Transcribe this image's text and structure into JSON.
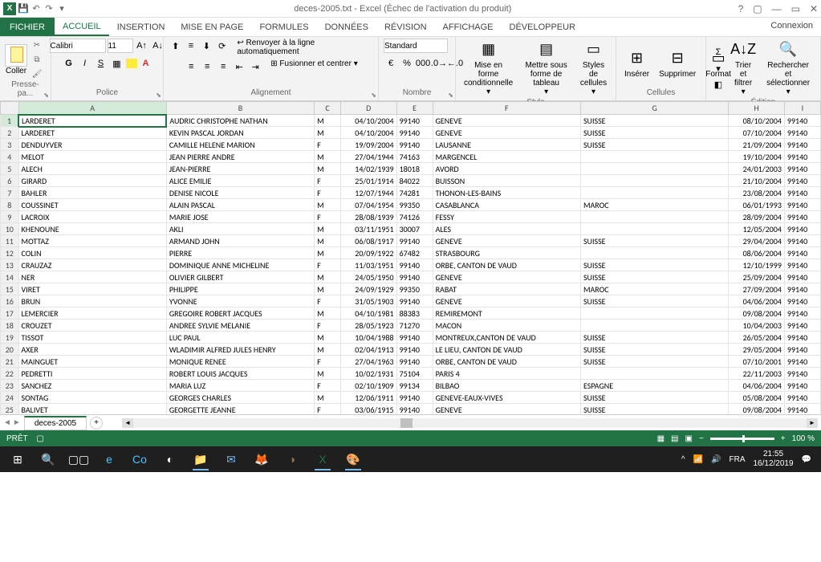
{
  "title": "deces-2005.txt - Excel (Échec de l'activation du produit)",
  "win_controls": {
    "help": "?",
    "ribbon_opts": "▢",
    "min": "—",
    "restore": "▭",
    "close": "✕"
  },
  "connexion": "Connexion",
  "tabs": {
    "fichier": "FICHIER",
    "accueil": "ACCUEIL",
    "insertion": "INSERTION",
    "mise_en_page": "MISE EN PAGE",
    "formules": "FORMULES",
    "donnees": "DONNÉES",
    "revision": "RÉVISION",
    "affichage": "AFFICHAGE",
    "developpeur": "DÉVELOPPEUR"
  },
  "ribbon": {
    "presse": {
      "label": "Presse-pa...",
      "coller": "Coller"
    },
    "police": {
      "label": "Police",
      "font": "Calibri",
      "size": "11"
    },
    "alignement": {
      "label": "Alignement",
      "wrap": "Renvoyer à la ligne automatiquement",
      "merge": "Fusionner et centrer"
    },
    "nombre": {
      "label": "Nombre",
      "format": "Standard"
    },
    "style": {
      "label": "Style",
      "conditional": "Mise en forme conditionnelle",
      "table": "Mettre sous forme de tableau",
      "cell": "Styles de cellules"
    },
    "cellules": {
      "label": "Cellules",
      "insert": "Insérer",
      "delete": "Supprimer",
      "format": "Format"
    },
    "edition": {
      "label": "Édition",
      "sort": "Trier et filtrer",
      "find": "Rechercher et sélectionner"
    }
  },
  "columns": [
    "A",
    "B",
    "C",
    "D",
    "E",
    "F",
    "G",
    "H",
    "I"
  ],
  "rows": [
    {
      "n": 1,
      "A": "LARDERET",
      "B": "AUDRIC CHRISTOPHE NATHAN",
      "C": "M",
      "D": "04/10/2004",
      "E": "99140",
      "F": "GENEVE",
      "G": "SUISSE",
      "H": "08/10/2004",
      "I": "99140"
    },
    {
      "n": 2,
      "A": "LARDERET",
      "B": "KEVIN PASCAL JORDAN",
      "C": "M",
      "D": "04/10/2004",
      "E": "99140",
      "F": "GENEVE",
      "G": "SUISSE",
      "H": "07/10/2004",
      "I": "99140"
    },
    {
      "n": 3,
      "A": "DENDUYVER",
      "B": "CAMILLE HELENE MARION",
      "C": "F",
      "D": "19/09/2004",
      "E": "99140",
      "F": "LAUSANNE",
      "G": "SUISSE",
      "H": "21/09/2004",
      "I": "99140"
    },
    {
      "n": 4,
      "A": "MELOT",
      "B": "JEAN PIERRE ANDRE",
      "C": "M",
      "D": "27/04/1944",
      "E": "74163",
      "F": "MARGENCEL",
      "G": "",
      "H": "19/10/2004",
      "I": "99140"
    },
    {
      "n": 5,
      "A": "ALECH",
      "B": "JEAN-PIERRE",
      "C": "M",
      "D": "14/02/1939",
      "E": "18018",
      "F": "AVORD",
      "G": "",
      "H": "24/01/2003",
      "I": "99140"
    },
    {
      "n": 6,
      "A": "GIRARD",
      "B": "ALICE EMILIE",
      "C": "F",
      "D": "25/01/1914",
      "E": "84022",
      "F": "BUISSON",
      "G": "",
      "H": "21/10/2004",
      "I": "99140"
    },
    {
      "n": 7,
      "A": "BAHLER",
      "B": "DENISE NICOLE",
      "C": "F",
      "D": "12/07/1944",
      "E": "74281",
      "F": "THONON-LES-BAINS",
      "G": "",
      "H": "23/08/2004",
      "I": "99140"
    },
    {
      "n": 8,
      "A": "COUSSINET",
      "B": "ALAIN PASCAL",
      "C": "M",
      "D": "07/04/1954",
      "E": "99350",
      "F": "CASABLANCA",
      "G": "MAROC",
      "H": "06/01/1993",
      "I": "99140"
    },
    {
      "n": 9,
      "A": "LACROIX",
      "B": "MARIE JOSE",
      "C": "F",
      "D": "28/08/1939",
      "E": "74126",
      "F": "FESSY",
      "G": "",
      "H": "28/09/2004",
      "I": "99140"
    },
    {
      "n": 10,
      "A": "KHENOUNE",
      "B": "AKLI",
      "C": "M",
      "D": "03/11/1951",
      "E": "30007",
      "F": "ALES",
      "G": "",
      "H": "12/05/2004",
      "I": "99140"
    },
    {
      "n": 11,
      "A": "MOTTAZ",
      "B": "ARMAND JOHN",
      "C": "M",
      "D": "06/08/1917",
      "E": "99140",
      "F": "GENEVE",
      "G": "SUISSE",
      "H": "29/04/2004",
      "I": "99140"
    },
    {
      "n": 12,
      "A": "COLIN",
      "B": "PIERRE",
      "C": "M",
      "D": "20/09/1922",
      "E": "67482",
      "F": "STRASBOURG",
      "G": "",
      "H": "08/06/2004",
      "I": "99140"
    },
    {
      "n": 13,
      "A": "CRAUZAZ",
      "B": "DOMINIQUE ANNE MICHELINE",
      "C": "F",
      "D": "11/03/1951",
      "E": "99140",
      "F": "ORBE, CANTON DE VAUD",
      "G": "SUISSE",
      "H": "12/10/1999",
      "I": "99140"
    },
    {
      "n": 14,
      "A": "NER",
      "B": "OLIVIER GILBERT",
      "C": "M",
      "D": "24/05/1950",
      "E": "99140",
      "F": "GENEVE",
      "G": "SUISSE",
      "H": "25/09/2004",
      "I": "99140"
    },
    {
      "n": 15,
      "A": "VIRET",
      "B": "PHILIPPE",
      "C": "M",
      "D": "24/09/1929",
      "E": "99350",
      "F": "RABAT",
      "G": "MAROC",
      "H": "27/09/2004",
      "I": "99140"
    },
    {
      "n": 16,
      "A": "BRUN",
      "B": "YVONNE",
      "C": "F",
      "D": "31/05/1903",
      "E": "99140",
      "F": "GENEVE",
      "G": "SUISSE",
      "H": "04/06/2004",
      "I": "99140"
    },
    {
      "n": 17,
      "A": "LEMERCIER",
      "B": "GREGOIRE ROBERT JACQUES",
      "C": "M",
      "D": "04/10/1981",
      "E": "88383",
      "F": "REMIREMONT",
      "G": "",
      "H": "09/08/2004",
      "I": "99140"
    },
    {
      "n": 18,
      "A": "CROUZET",
      "B": "ANDREE SYLVIE MELANIE",
      "C": "F",
      "D": "28/05/1923",
      "E": "71270",
      "F": "MACON",
      "G": "",
      "H": "10/04/2003",
      "I": "99140"
    },
    {
      "n": 19,
      "A": "TISSOT",
      "B": "LUC PAUL",
      "C": "M",
      "D": "10/04/1988",
      "E": "99140",
      "F": "MONTREUX,CANTON DE VAUD",
      "G": "SUISSE",
      "H": "26/05/2004",
      "I": "99140"
    },
    {
      "n": 20,
      "A": "AXER",
      "B": "WLADIMIR ALFRED JULES HENRY",
      "C": "M",
      "D": "02/04/1913",
      "E": "99140",
      "F": "LE LIEU, CANTON DE VAUD",
      "G": "SUISSE",
      "H": "29/05/2004",
      "I": "99140"
    },
    {
      "n": 21,
      "A": "MAINGUET",
      "B": "MONIQUE RENEE",
      "C": "F",
      "D": "27/04/1963",
      "E": "99140",
      "F": "ORBE, CANTON DE VAUD",
      "G": "SUISSE",
      "H": "07/10/2001",
      "I": "99140"
    },
    {
      "n": 22,
      "A": "PEDRETTI",
      "B": "ROBERT LOUIS JACQUES",
      "C": "M",
      "D": "10/02/1931",
      "E": "75104",
      "F": "PARIS 4",
      "G": "",
      "H": "22/11/2003",
      "I": "99140"
    },
    {
      "n": 23,
      "A": "SANCHEZ",
      "B": "MARIA LUZ",
      "C": "F",
      "D": "02/10/1909",
      "E": "99134",
      "F": "BILBAO",
      "G": "ESPAGNE",
      "H": "04/06/2004",
      "I": "99140"
    },
    {
      "n": 24,
      "A": "SONTAG",
      "B": "GEORGES CHARLES",
      "C": "M",
      "D": "12/06/1911",
      "E": "99140",
      "F": "GENEVE-EAUX-VIVES",
      "G": "SUISSE",
      "H": "05/08/2004",
      "I": "99140"
    },
    {
      "n": 25,
      "A": "BALIVET",
      "B": "GEORGETTE JEANNE",
      "C": "F",
      "D": "03/06/1915",
      "E": "99140",
      "F": "GENEVE",
      "G": "SUISSE",
      "H": "09/08/2004",
      "I": "99140"
    }
  ],
  "sheet_tab": "deces-2005",
  "status": {
    "ready": "PRÊT",
    "zoom": "100 %"
  },
  "taskbar": {
    "lang": "FRA",
    "time": "21:55",
    "date": "16/12/2019"
  }
}
